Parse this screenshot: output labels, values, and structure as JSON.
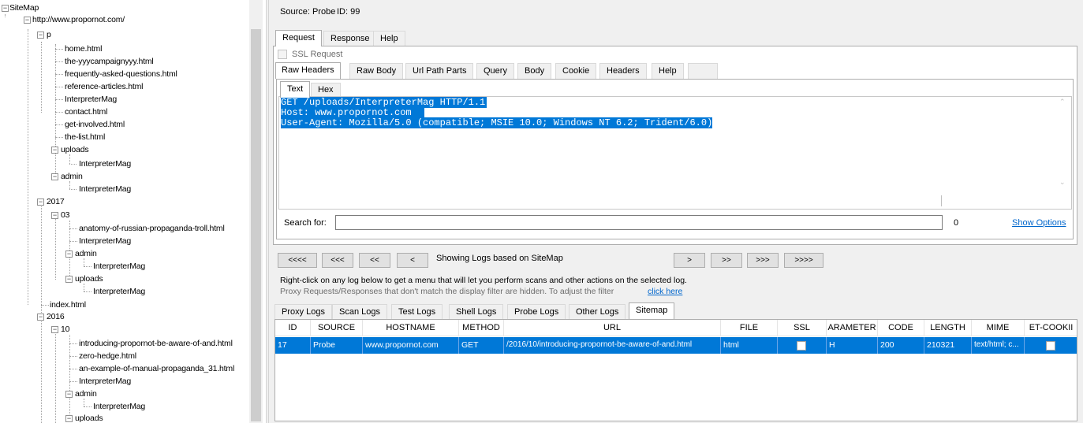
{
  "tree": {
    "root": "SiteMap",
    "site": "http://www.propornot.com/",
    "p": "p",
    "p_items": [
      "home.html",
      "the-yyycampaignyyy.html",
      "frequently-asked-questions.html",
      "reference-articles.html",
      "InterpreterMag",
      "contact.html",
      "get-involved.html",
      "the-list.html"
    ],
    "uploads": "uploads",
    "interp": "InterpreterMag",
    "admin": "admin",
    "y2017": "2017",
    "m03": "03",
    "m03_items": [
      "anatomy-of-russian-propaganda-troll.html",
      "InterpreterMag"
    ],
    "index": "index.html",
    "y2016": "2016",
    "m10": "10",
    "m10_items": [
      "introducing-propornot-be-aware-of-and.html",
      "zero-hedge.html",
      "an-example-of-manual-propaganda_31.html",
      "InterpreterMag"
    ]
  },
  "header": {
    "source": "Source: Probe",
    "id": "ID: 99"
  },
  "main_tabs": [
    "Request",
    "Response",
    "Help"
  ],
  "ssl_request": "SSL Request",
  "sub_tabs": [
    "Raw Headers",
    "Raw Body",
    "Url Path Parts",
    "Query",
    "Body",
    "Cookie",
    "Headers",
    "Help"
  ],
  "view_tabs": [
    "Text",
    "Hex"
  ],
  "request_lines": [
    "GET /uploads/InterpreterMag HTTP/1.1",
    "Host: www.propornot.com",
    "User-Agent: Mozilla/5.0 (compatible; MSIE 10.0; Windows NT 6.2; Trident/6.0)"
  ],
  "search": {
    "label": "Search for:",
    "value": "",
    "count": "0",
    "show_options": "Show Options"
  },
  "nav": {
    "b4": "<<<<",
    "b3": "<<<",
    "b2": "<<",
    "b1": "<",
    "status": "Showing Logs based on SiteMap",
    "f1": ">",
    "f2": ">>",
    "f3": ">>>",
    "f4": ">>>>"
  },
  "info": {
    "line1": "Right-click on any log below to get a menu that will let you perform scans and other actions on the selected log.",
    "line2": "Proxy Requests/Responses that don't match the display filter are hidden. To adjust the filter",
    "link": "click here"
  },
  "log_tabs": [
    "Proxy Logs",
    "Scan Logs",
    "Test Logs",
    "Shell Logs",
    "Probe Logs",
    "Other Logs",
    "Sitemap"
  ],
  "columns": [
    "ID",
    "SOURCE",
    "HOSTNAME",
    "METHOD",
    "URL",
    "FILE",
    "SSL",
    "ARAMETER",
    "CODE",
    "LENGTH",
    "MIME",
    "ET-COOKII"
  ],
  "row": {
    "id": "17",
    "source": "Probe",
    "hostname": "www.propornot.com",
    "method": "GET",
    "url": "/2016/10/introducing-propornot-be-aware-of-and.html",
    "file": "html",
    "param": "H",
    "code": "200",
    "length": "210321",
    "mime": "text/html; c..."
  },
  "colors": {
    "selection": "#0078d7",
    "link": "#0066cc"
  }
}
